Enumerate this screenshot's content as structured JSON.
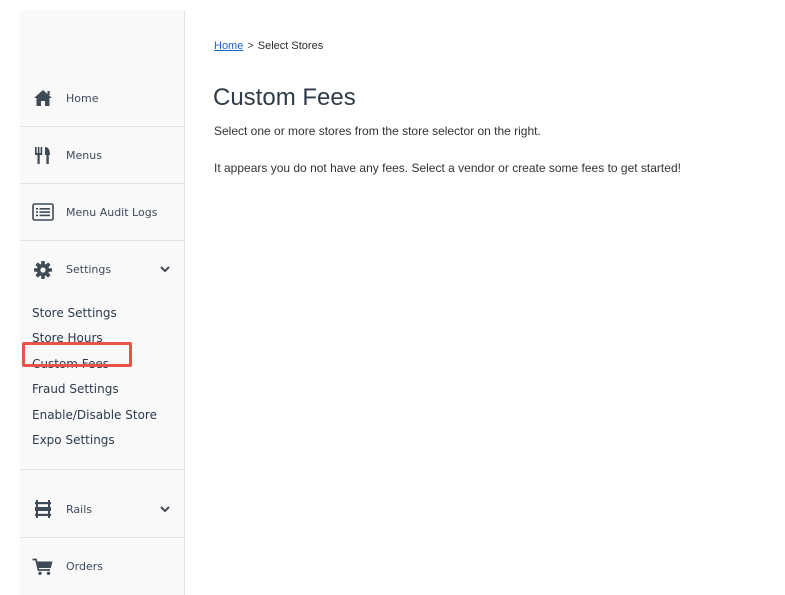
{
  "breadcrumb": {
    "home": "Home",
    "separator": ">",
    "current": "Select Stores"
  },
  "page": {
    "title": "Custom Fees",
    "instruction": "Select one or more stores from the store selector on the right.",
    "empty_message": "It appears you do not have any fees. Select a vendor or create some fees to get started!"
  },
  "sidebar": {
    "items": [
      {
        "label": "Home",
        "icon": "home-icon"
      },
      {
        "label": "Menus",
        "icon": "utensils-icon"
      },
      {
        "label": "Menu Audit Logs",
        "icon": "list-icon"
      },
      {
        "label": "Settings",
        "icon": "gear-icon",
        "expanded": true
      },
      {
        "label": "Rails",
        "icon": "rails-icon"
      },
      {
        "label": "Orders",
        "icon": "cart-icon"
      }
    ],
    "settings_sub_items": [
      "Store Settings",
      "Store Hours",
      "Custom Fees",
      "Fraud Settings",
      "Enable/Disable Store",
      "Expo Settings"
    ],
    "highlighted_sub_item": "Custom Fees"
  },
  "colors": {
    "highlight": "#e8544a",
    "link": "#1a64c8",
    "icon": "#3f4a57"
  }
}
